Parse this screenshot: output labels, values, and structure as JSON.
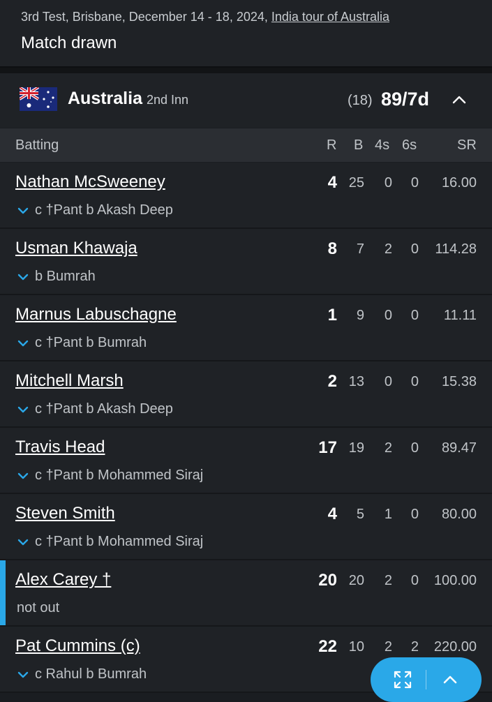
{
  "match": {
    "info_prefix": "3rd Test, Brisbane, December 14 - 18, 2024, ",
    "series_link": "India tour of Australia",
    "result": "Match drawn"
  },
  "team": {
    "name": "Australia",
    "innings": "2nd Inn",
    "overs": "(18)",
    "score": "89/7d"
  },
  "columns": {
    "batting": "Batting",
    "r": "R",
    "b": "B",
    "fours": "4s",
    "sixes": "6s",
    "sr": "SR"
  },
  "batters": [
    {
      "name": "Nathan McSweeney",
      "dismissal": "c †Pant b Akash Deep",
      "r": "4",
      "b": "25",
      "fours": "0",
      "sixes": "0",
      "sr": "16.00",
      "expandable": true,
      "active": false
    },
    {
      "name": "Usman Khawaja",
      "dismissal": "b Bumrah",
      "r": "8",
      "b": "7",
      "fours": "2",
      "sixes": "0",
      "sr": "114.28",
      "expandable": true,
      "active": false
    },
    {
      "name": "Marnus Labuschagne",
      "dismissal": "c †Pant b Bumrah",
      "r": "1",
      "b": "9",
      "fours": "0",
      "sixes": "0",
      "sr": "11.11",
      "expandable": true,
      "active": false
    },
    {
      "name": "Mitchell Marsh",
      "dismissal": "c †Pant b Akash Deep",
      "r": "2",
      "b": "13",
      "fours": "0",
      "sixes": "0",
      "sr": "15.38",
      "expandable": true,
      "active": false
    },
    {
      "name": "Travis Head",
      "dismissal": "c †Pant b Mohammed Siraj",
      "r": "17",
      "b": "19",
      "fours": "2",
      "sixes": "0",
      "sr": "89.47",
      "expandable": true,
      "active": false
    },
    {
      "name": "Steven Smith",
      "dismissal": "c †Pant b Mohammed Siraj",
      "r": "4",
      "b": "5",
      "fours": "1",
      "sixes": "0",
      "sr": "80.00",
      "expandable": true,
      "active": false
    },
    {
      "name": "Alex Carey †",
      "dismissal": "not out",
      "r": "20",
      "b": "20",
      "fours": "2",
      "sixes": "0",
      "sr": "100.00",
      "expandable": false,
      "active": true
    },
    {
      "name": "Pat Cummins (c)",
      "dismissal": "c Rahul b Bumrah",
      "r": "22",
      "b": "10",
      "fours": "2",
      "sixes": "2",
      "sr": "220.00",
      "expandable": true,
      "active": false
    }
  ],
  "icons": {
    "flag": "australia-flag-icon",
    "collapse": "chevron-up-icon",
    "expand_row": "chevron-down-icon",
    "fab_expand": "expand-arrows-icon",
    "fab_up": "chevron-up-icon"
  },
  "colors": {
    "accent": "#2aa8e8",
    "background": "#1f2226",
    "header_row": "#2b2e33"
  }
}
